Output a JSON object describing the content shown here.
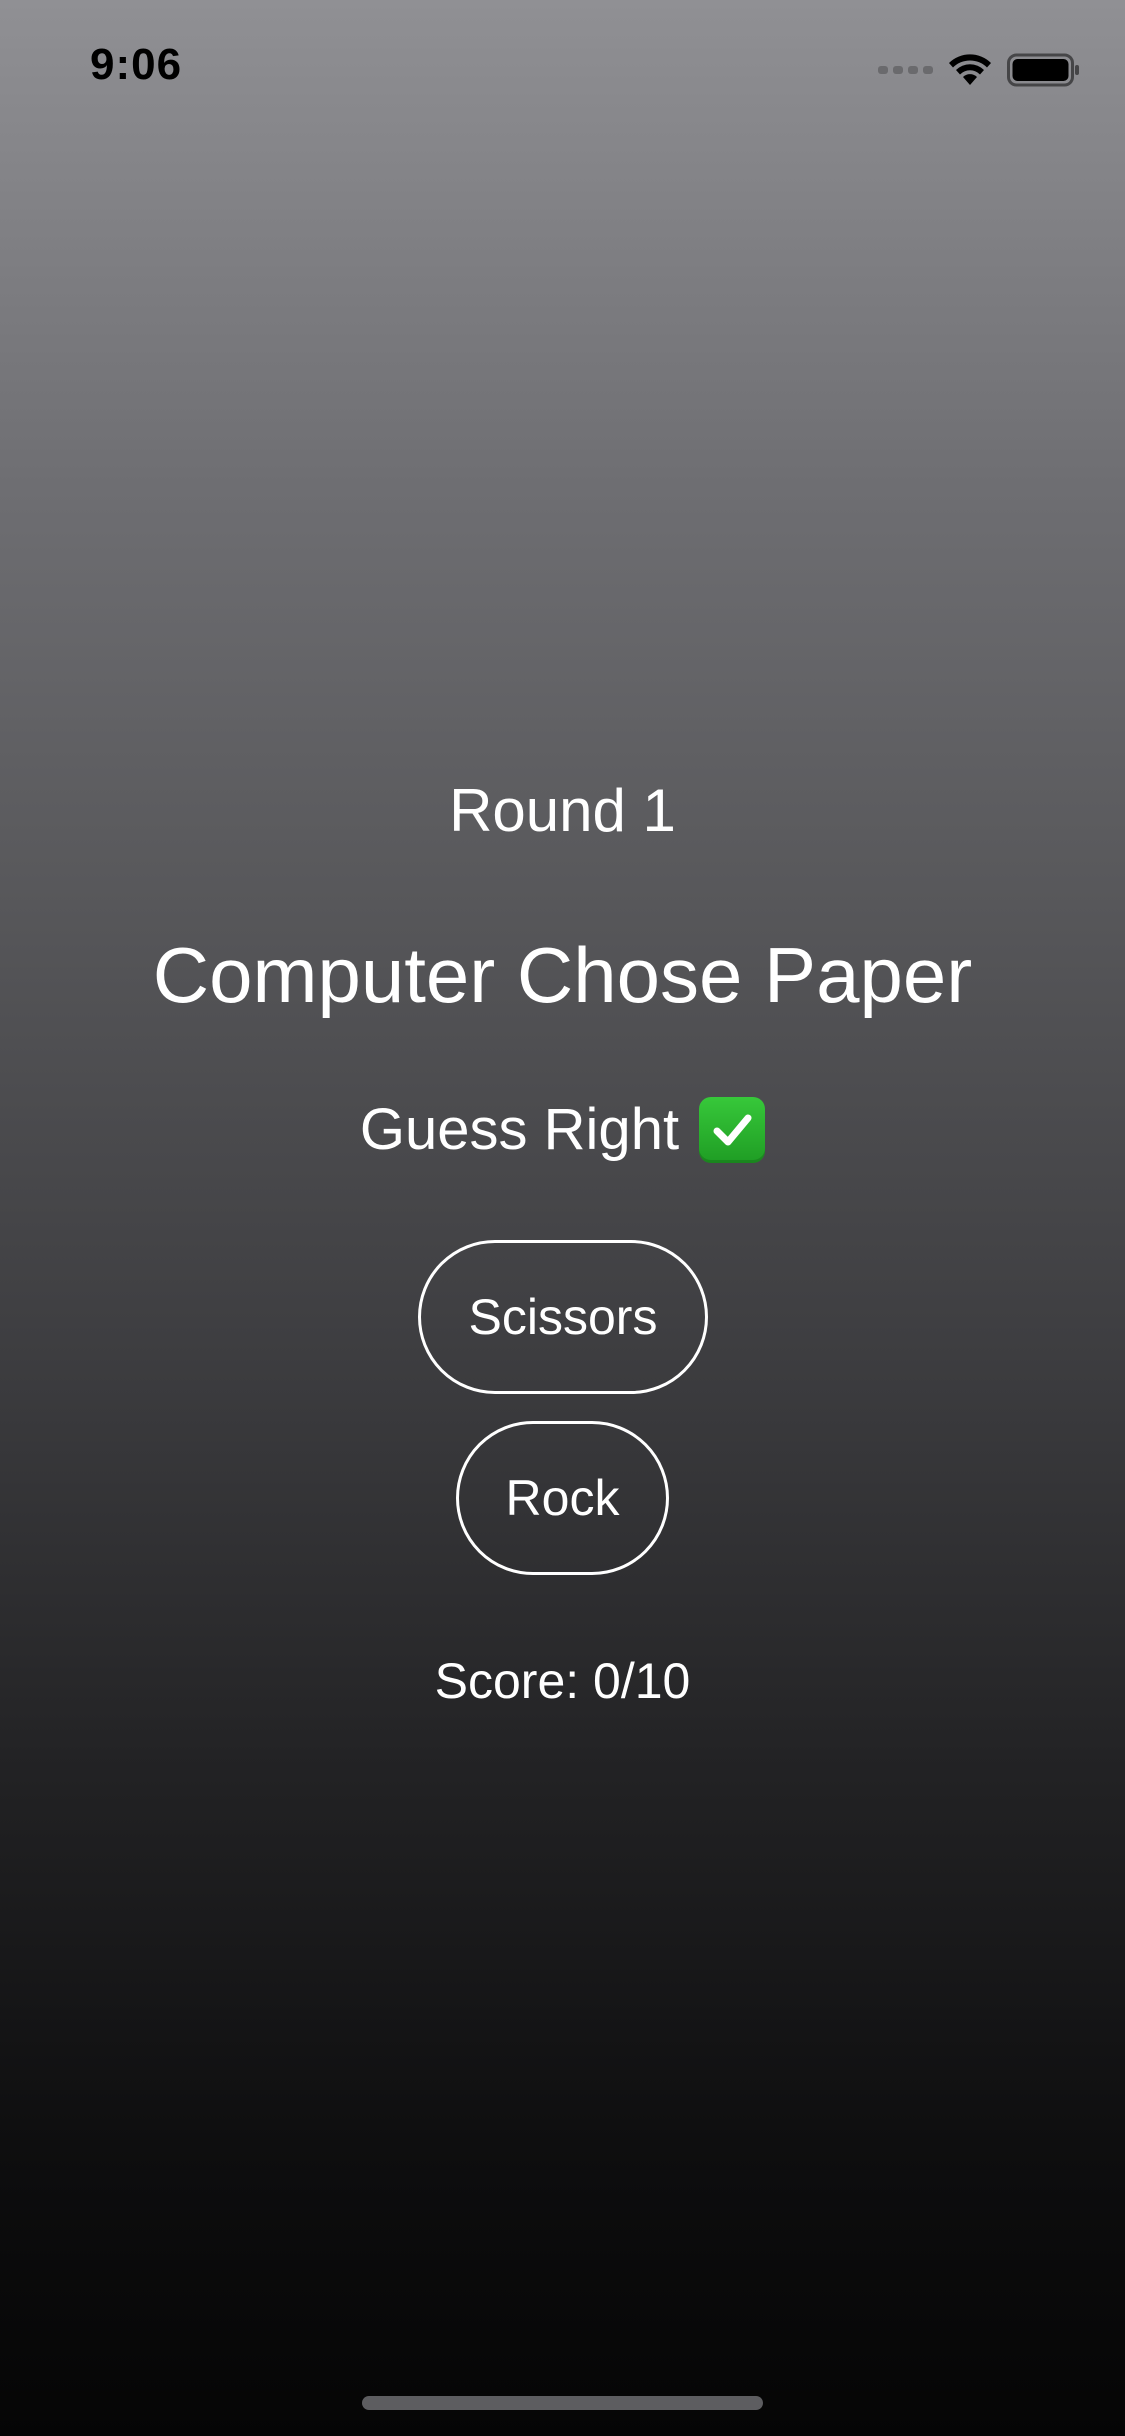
{
  "status_bar": {
    "time": "9:06",
    "icons": [
      "signal-icon",
      "wifi-icon",
      "battery-icon"
    ]
  },
  "game": {
    "round": "Round 1",
    "computer_choice": "Computer Chose Paper",
    "instruction": "Guess Right",
    "instruction_icon": "check-mark-button-icon",
    "options": [
      "Scissors",
      "Rock"
    ],
    "score": "Score: 0/10"
  },
  "colors": {
    "gradient_top": "#909094",
    "gradient_bottom": "#050505",
    "text": "#ffffff",
    "check_green": "#2bb32f"
  }
}
